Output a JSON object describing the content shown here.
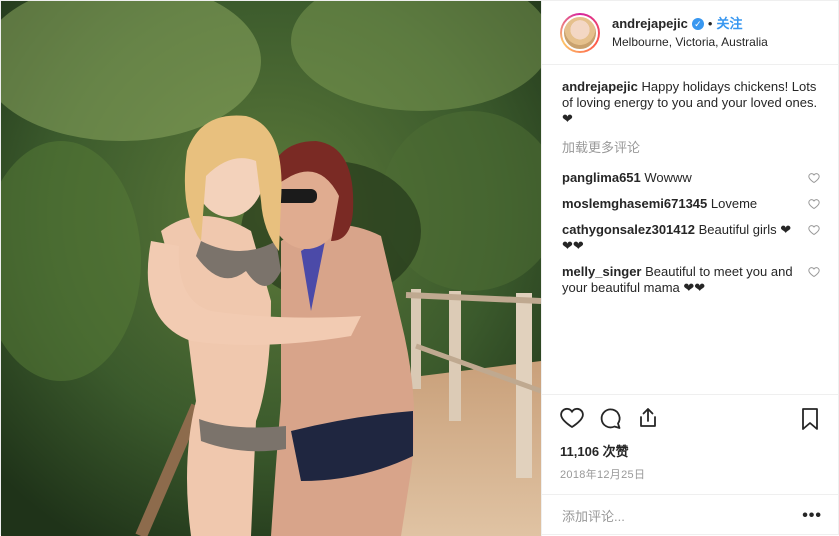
{
  "post": {
    "header": {
      "username": "andrejapejic",
      "separator": "•",
      "follow_label": "关注",
      "location": "Melbourne, Victoria, Australia"
    },
    "caption": {
      "username": "andrejapejic",
      "text": "Happy holidays chickens! Lots of loving energy to you and your loved ones. ❤"
    },
    "load_more_label": "加载更多评论",
    "comments": [
      {
        "username": "panglima651",
        "text": "Wowww"
      },
      {
        "username": "moslemghasemi671345",
        "text": "Loveme"
      },
      {
        "username": "cathygonsalez301412",
        "text": "Beautiful girls ❤❤❤"
      },
      {
        "username": "melly_singer",
        "text": "Beautiful to meet you and your beautiful mama ❤❤"
      }
    ],
    "likes_label": "11,106 次赞",
    "date": "2018年12月25日",
    "add_comment_placeholder": "添加评论...",
    "more_options": "•••"
  },
  "icons": {
    "like": "heart-icon",
    "comment": "comment-icon",
    "share": "share-icon",
    "save": "bookmark-icon",
    "verified": "verified-badge-icon"
  },
  "colors": {
    "accent": "#3897f0",
    "muted": "#999999",
    "text": "#262626"
  }
}
